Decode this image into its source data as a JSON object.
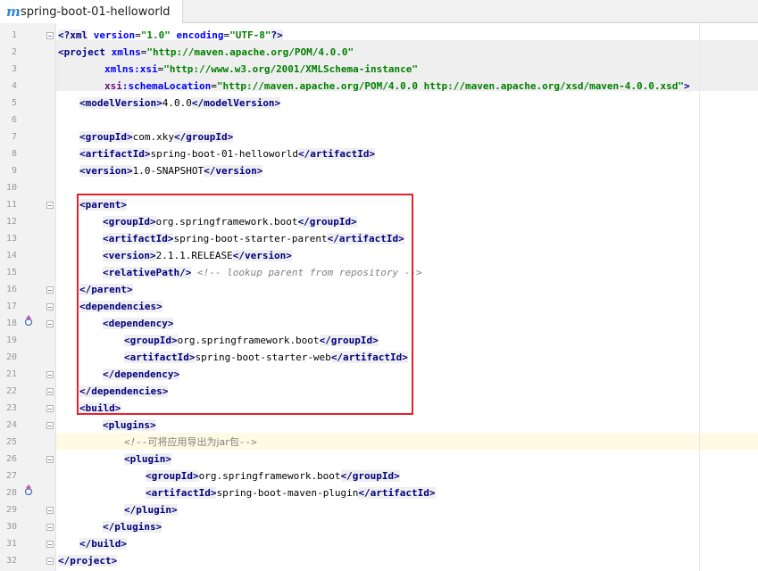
{
  "tab": {
    "icon": "maven-m-icon",
    "label": "spring-boot-01-helloworld"
  },
  "line_numbers": [
    "1",
    "2",
    "3",
    "4",
    "5",
    "6",
    "7",
    "8",
    "9",
    "10",
    "11",
    "12",
    "13",
    "14",
    "15",
    "16",
    "17",
    "18",
    "19",
    "20",
    "21",
    "22",
    "23",
    "24",
    "25",
    "26",
    "27",
    "28",
    "29",
    "30",
    "31",
    "32"
  ],
  "colors": {
    "tag": "#000080",
    "attr_name": "#0000ff",
    "attr_value": "#008000",
    "comment": "#808080",
    "highlight_box": "#e8202a"
  },
  "code": {
    "l1_open": "<?",
    "l1_xml": "xml",
    "l1_version_attr": "version",
    "l1_version_val": "\"1.0\"",
    "l1_encoding_attr": "encoding",
    "l1_encoding_val": "\"UTF-8\"",
    "l1_close": "?>",
    "l2_tag": "<project",
    "l2_attr": "xmlns",
    "l2_val": "\"http://maven.apache.org/POM/4.0.0\"",
    "l3_attr": "xmlns:xsi",
    "l3_val": "\"http://www.w3.org/2001/XMLSchema-instance\"",
    "l4_ns": "xsi",
    "l4_attr": ":schemaLocation",
    "l4_val": "\"http://maven.apache.org/POM/4.0.0 http://maven.apache.org/xsd/maven-4.0.0.xsd\"",
    "l4_close": ">",
    "l5_open": "<modelVersion>",
    "l5_text": "4.0.0",
    "l5_close": "</modelVersion>",
    "l7_open": "<groupId>",
    "l7_text": "com.xky",
    "l7_close": "</groupId>",
    "l8_open": "<artifactId>",
    "l8_text": "spring-boot-01-helloworld",
    "l8_close": "</artifactId>",
    "l9_open": "<version>",
    "l9_text": "1.0-SNAPSHOT",
    "l9_close": "</version>",
    "l11": "<parent>",
    "l12_open": "<groupId>",
    "l12_text": "org.springframework.boot",
    "l12_close": "</groupId>",
    "l13_open": "<artifactId>",
    "l13_text": "spring-boot-starter-parent",
    "l13_close": "</artifactId>",
    "l14_open": "<version>",
    "l14_text": "2.1.1.RELEASE",
    "l14_close": "</version>",
    "l15_tag": "<relativePath/>",
    "l15_comment": "<!-- lookup parent from repository -->",
    "l16": "</parent>",
    "l17": "<dependencies>",
    "l18": "<dependency>",
    "l19_open": "<groupId>",
    "l19_text": "org.springframework.boot",
    "l19_close": "</groupId>",
    "l20_open": "<artifactId>",
    "l20_text": "spring-boot-starter-web",
    "l20_close": "</artifactId>",
    "l21": "</dependency>",
    "l22": "</dependencies>",
    "l23": "<build>",
    "l24": "<plugins>",
    "l25_comment_open": "<!--",
    "l25_comment_text": "可将应用导出为jar包",
    "l25_comment_close": "-->",
    "l26": "<plugin>",
    "l27_open": "<groupId>",
    "l27_text": "org.springframework.boot",
    "l27_close": "</groupId>",
    "l28_open": "<artifactId>",
    "l28_text": "spring-boot-maven-plugin",
    "l28_close": "</artifactId>",
    "l29": "</plugin>",
    "l30": "</plugins>",
    "l31": "</build>",
    "l32": "</project>"
  }
}
